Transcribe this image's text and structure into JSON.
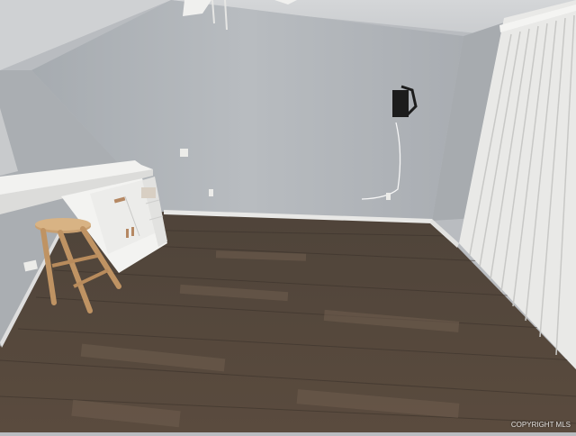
{
  "scene": {
    "description_id": "empty-room-photo",
    "watermark": "COPYRIGHT MLS",
    "colors": {
      "wall": "#b4b8bc",
      "wall_left": "#a9adb1",
      "ceiling": "#c9cccf",
      "floor_dark": "#4a3f36",
      "floor_light": "#7a6a5b",
      "baseboard": "#e8e8e6",
      "blinds": "#eeeeec",
      "cabinet": "#f2f2f0",
      "stool": "#c49a6c"
    },
    "objects": [
      "ceiling-fan",
      "tv-wall-mount",
      "wall-outlet",
      "light-switch",
      "countertop",
      "white-cabinet",
      "wooden-stool",
      "vertical-blinds",
      "laminate-floor",
      "baseboard"
    ]
  }
}
